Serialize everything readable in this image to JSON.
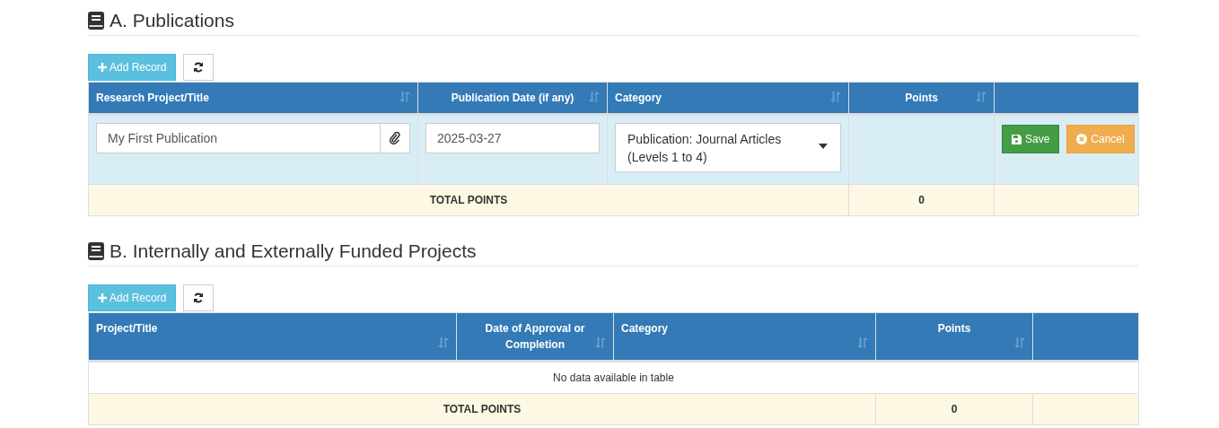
{
  "sections": [
    {
      "title": "A. Publications",
      "add_button": "Add Record",
      "columns": [
        {
          "label": "Research Project/Title",
          "sortable": true
        },
        {
          "label": "Publication Date (if any)",
          "sortable": true
        },
        {
          "label": "Category",
          "sortable": true
        },
        {
          "label": "Points",
          "sortable": true
        },
        {
          "sortable": false
        }
      ],
      "edit_row": {
        "title": "My First Publication",
        "date": "2025-03-27",
        "category": "Publication: Journal Articles (Levels 1 to 4)",
        "save": "Save",
        "cancel": "Cancel"
      },
      "total": {
        "label": "TOTAL POINTS",
        "value": "0"
      }
    },
    {
      "title": "B. Internally and Externally Funded Projects",
      "add_button": "Add Record",
      "columns": [
        {
          "label": "Project/Title",
          "sortable": true
        },
        {
          "label": "Date of Approval or Completion",
          "sortable": true
        },
        {
          "label": "Category",
          "sortable": true
        },
        {
          "label": "Points",
          "sortable": true
        },
        {
          "sortable": false
        }
      ],
      "empty_text": "No data available in table",
      "total": {
        "label": "TOTAL POINTS",
        "value": "0"
      }
    }
  ]
}
